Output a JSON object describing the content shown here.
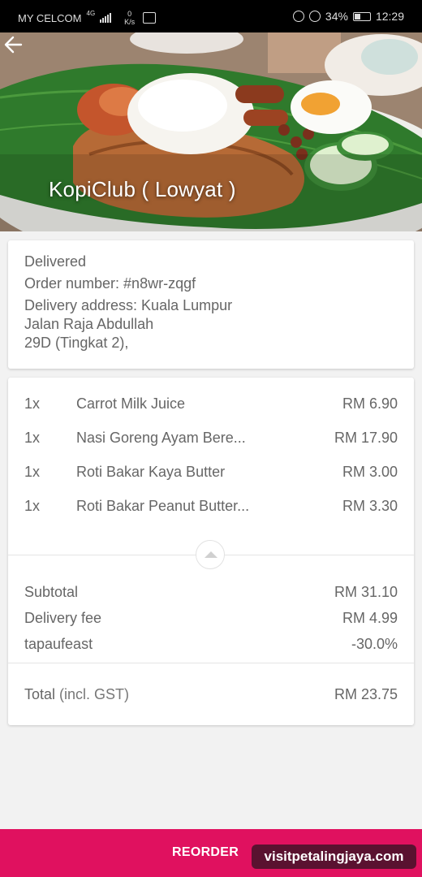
{
  "status_bar": {
    "carrier": "MY CELCOM",
    "network": "4G",
    "speed_value": "0",
    "speed_unit": "K/s",
    "battery": "34%",
    "time": "12:29"
  },
  "header": {
    "restaurant_name": "KopiClub ( Lowyat )",
    "back_icon": "arrow-left-icon"
  },
  "order_info": {
    "status": "Delivered",
    "order_number": "Order number: #n8wr-zqgf",
    "address_line1": "Delivery address: Kuala Lumpur",
    "address_line2": "Jalan Raja Abdullah",
    "address_line3": "29D (Tingkat 2),"
  },
  "items": [
    {
      "qty": "1x",
      "name": "Carrot Milk Juice",
      "price": "RM 6.90"
    },
    {
      "qty": "1x",
      "name": "Nasi Goreng Ayam Bere...",
      "price": "RM 17.90"
    },
    {
      "qty": "1x",
      "name": "Roti Bakar Kaya Butter",
      "price": "RM 3.00"
    },
    {
      "qty": "1x",
      "name": "Roti Bakar Peanut Butter...",
      "price": "RM 3.30"
    }
  ],
  "summary": {
    "subtotal_label": "Subtotal",
    "subtotal_value": "RM 31.10",
    "delivery_label": "Delivery fee",
    "delivery_value": "RM 4.99",
    "promo_label": "tapaufeast",
    "promo_value": "-30.0%",
    "total_label": "Total",
    "total_note": "(incl. GST)",
    "total_value": "RM 23.75"
  },
  "footer": {
    "reorder_label": "REORDER",
    "watermark": "visitpetalingjaya.com"
  },
  "colors": {
    "accent": "#e0115f",
    "text": "#666666",
    "background": "#f2f2f2"
  }
}
